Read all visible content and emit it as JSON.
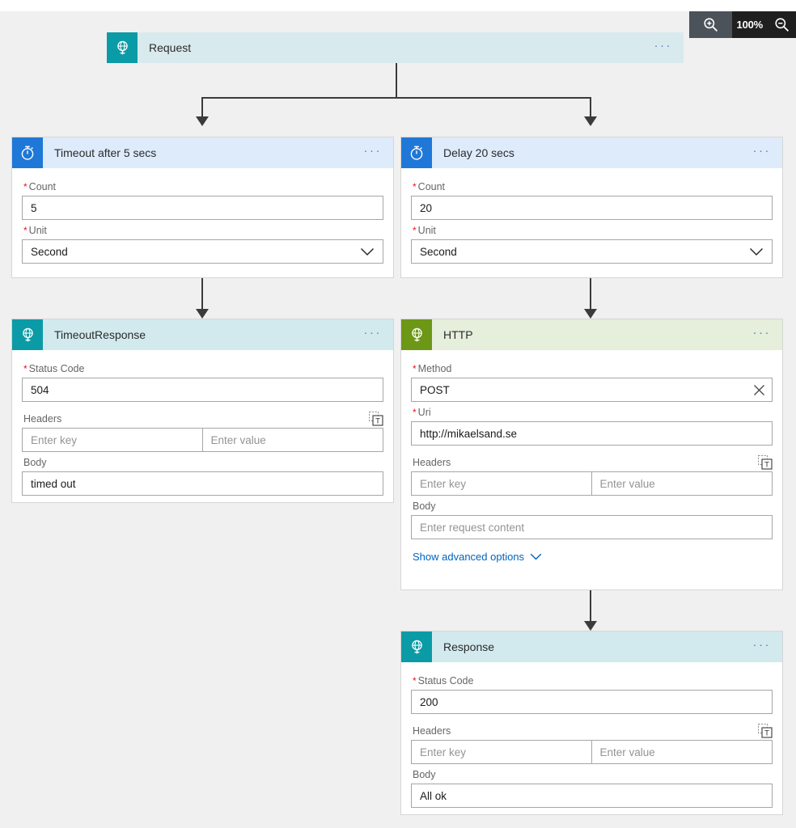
{
  "zoom_control": {
    "zoom_in_icon": "magnifier-plus-icon",
    "zoom_out_icon": "magnifier-minus-icon",
    "level": "100%"
  },
  "designer": {
    "nodes": [
      {
        "id": "request",
        "title": "Request",
        "icon": "request-globe-icon",
        "header_bg": "#d9eaee",
        "icon_bg": "#0b9ba6",
        "menu": "···",
        "collapsed": true
      },
      {
        "id": "timeout",
        "title": "Timeout after 5 secs",
        "icon": "stopwatch-icon",
        "header_bg": "#deebfb",
        "icon_bg": "#1f78d8",
        "menu": "···",
        "fields": [
          {
            "name": "count",
            "label": "Count",
            "required": true,
            "type": "text",
            "value": "5"
          },
          {
            "name": "unit",
            "label": "Unit",
            "required": true,
            "type": "select",
            "value": "Second"
          }
        ]
      },
      {
        "id": "delay",
        "title": "Delay 20 secs",
        "icon": "stopwatch-icon",
        "header_bg": "#deebfb",
        "icon_bg": "#1f78d8",
        "menu": "···",
        "fields": [
          {
            "name": "count",
            "label": "Count",
            "required": true,
            "type": "text",
            "value": "20"
          },
          {
            "name": "unit",
            "label": "Unit",
            "required": true,
            "type": "select",
            "value": "Second"
          }
        ]
      },
      {
        "id": "timeoutresponse",
        "title": "TimeoutResponse",
        "icon": "response-globe-icon",
        "header_bg": "#d2eaee",
        "icon_bg": "#0b9ba6",
        "menu": "···",
        "fields": [
          {
            "name": "status-code",
            "label": "Status Code",
            "required": true,
            "type": "text",
            "value": "504"
          },
          {
            "name": "headers",
            "label": "Headers",
            "required": false,
            "type": "keyvalue",
            "key_placeholder": "Enter key",
            "value_placeholder": "Enter value",
            "tool_icon": "text-mode-icon"
          },
          {
            "name": "body",
            "label": "Body",
            "required": false,
            "type": "text",
            "value": "timed out"
          }
        ]
      },
      {
        "id": "http",
        "title": "HTTP",
        "icon": "http-globe-icon",
        "header_bg": "#e6eedc",
        "icon_bg": "#6d9717",
        "menu": "···",
        "fields": [
          {
            "name": "method",
            "label": "Method",
            "required": true,
            "type": "text",
            "value": "POST",
            "clear_icon": "close-icon"
          },
          {
            "name": "uri",
            "label": "Uri",
            "required": true,
            "type": "text",
            "value": "http://mikaelsand.se"
          },
          {
            "name": "headers",
            "label": "Headers",
            "required": false,
            "type": "keyvalue",
            "key_placeholder": "Enter key",
            "value_placeholder": "Enter value",
            "tool_icon": "text-mode-icon"
          },
          {
            "name": "body",
            "label": "Body",
            "required": false,
            "type": "text",
            "value": "",
            "placeholder": "Enter request content"
          }
        ],
        "advanced_link": {
          "label": "Show advanced options",
          "icon": "chevron-down-icon",
          "color": "#0064bf"
        }
      },
      {
        "id": "response",
        "title": "Response",
        "icon": "response-globe-icon",
        "header_bg": "#d2eaee",
        "icon_bg": "#0b9ba6",
        "menu": "···",
        "fields": [
          {
            "name": "status-code",
            "label": "Status Code",
            "required": true,
            "type": "text",
            "value": "200"
          },
          {
            "name": "headers",
            "label": "Headers",
            "required": false,
            "type": "keyvalue",
            "key_placeholder": "Enter key",
            "value_placeholder": "Enter value",
            "tool_icon": "text-mode-icon"
          },
          {
            "name": "body",
            "label": "Body",
            "required": false,
            "type": "text",
            "value": "All ok"
          }
        ]
      }
    ]
  }
}
